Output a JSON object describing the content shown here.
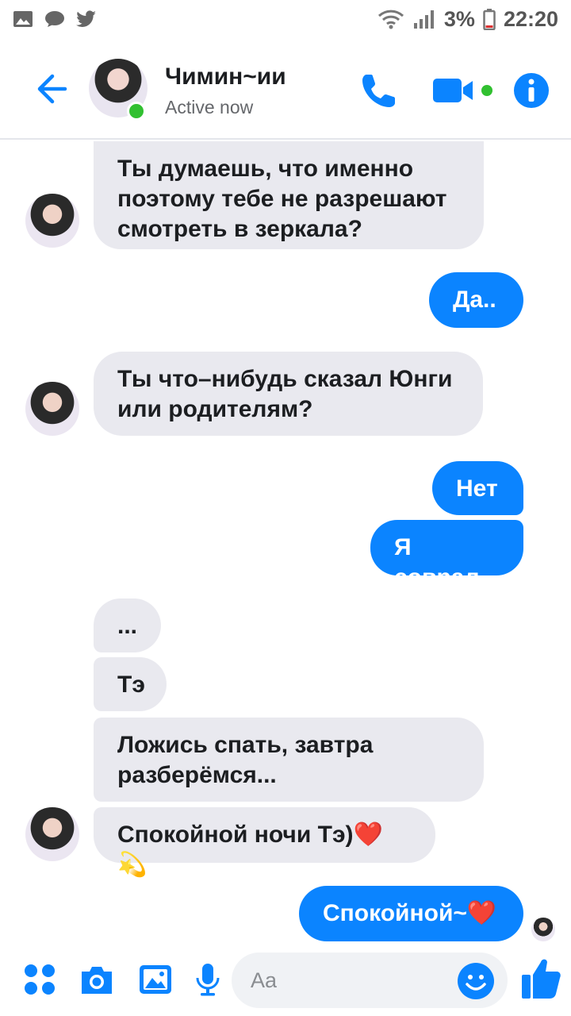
{
  "status_bar": {
    "battery": "3%",
    "time": "22:20"
  },
  "header": {
    "name": "Чимин~ии",
    "status": "Active now"
  },
  "messages": [
    {
      "dir": "in",
      "text_lines": [
        "Ты думаешь, что именно",
        "поэтому тебе не разрешают",
        "смотреть в зеркала?"
      ]
    },
    {
      "dir": "out",
      "text": "Да.."
    },
    {
      "dir": "in",
      "text_lines": [
        "Ты что–нибудь сказал Юнги",
        "или родителям?"
      ]
    },
    {
      "dir": "out",
      "text": "Нет"
    },
    {
      "dir": "out",
      "text": "Я соврал"
    },
    {
      "dir": "in",
      "text": "..."
    },
    {
      "dir": "in",
      "text": "Тэ"
    },
    {
      "dir": "in",
      "text_lines": [
        "Ложись спать, завтра",
        "разберёмся..."
      ]
    },
    {
      "dir": "in",
      "text": "Спокойной ночи Тэ)❤️💫"
    },
    {
      "dir": "out",
      "text": "Спокойной~❤️"
    }
  ],
  "composer": {
    "placeholder": "Aa"
  },
  "colors": {
    "accent": "#0b84ff",
    "incoming_bubble": "#e9e9ef",
    "online": "#31c030"
  },
  "icons": [
    "back-arrow-icon",
    "phone-icon",
    "video-camera-icon",
    "info-icon",
    "apps-icon",
    "camera-icon",
    "gallery-icon",
    "microphone-icon",
    "emoji-icon",
    "thumbs-up-icon"
  ]
}
